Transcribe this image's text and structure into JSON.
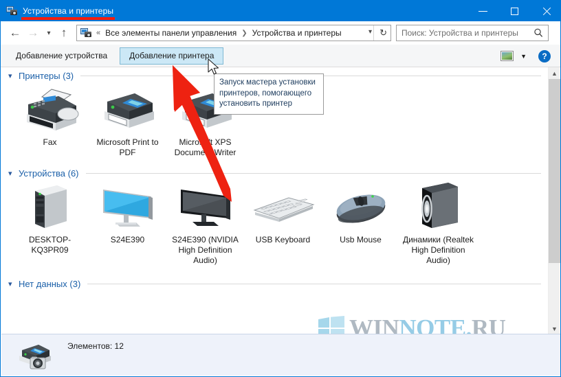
{
  "window": {
    "title": "Устройства и принтеры",
    "title_icon": "devices-printers-icon",
    "minimize_label": "Свернуть",
    "maximize_label": "Развернуть",
    "close_label": "Закрыть"
  },
  "address_bar": {
    "back_icon": "back-arrow-icon",
    "forward_icon": "forward-arrow-icon",
    "recent_icon": "recent-locations-icon",
    "up_icon": "up-arrow-icon",
    "overflow": "«",
    "crumb_icon": "devices-printers-icon",
    "crumbs": [
      "Все элементы панели управления",
      "Устройства и принтеры"
    ],
    "separator": "❯",
    "dropdown_icon": "chevron-down-icon",
    "refresh_icon": "refresh-icon"
  },
  "search": {
    "placeholder": "Поиск: Устройства и принтеры",
    "value": "",
    "icon": "search-icon"
  },
  "command_bar": {
    "add_device": "Добавление устройства",
    "add_printer": "Добавление принтера",
    "view_icon": "change-view-icon",
    "view_dropdown_icon": "chevron-down-icon",
    "help_label": "?",
    "help_icon": "help-icon"
  },
  "tooltip": {
    "text": "Запуск мастера установки принтеров, помогающего установить принтер"
  },
  "sections": [
    {
      "chevron": "⌄",
      "label": "Принтеры (3)",
      "name": "printers",
      "items": [
        {
          "label": "Fax",
          "icon": "fax-printer-icon"
        },
        {
          "label": "Microsoft Print to PDF",
          "icon": "printer-icon"
        },
        {
          "label": "Microsoft XPS Document Writer",
          "icon": "printer-icon"
        }
      ]
    },
    {
      "chevron": "⌄",
      "label": "Устройства (6)",
      "name": "devices",
      "items": [
        {
          "label": "DESKTOP-KQ3PR09",
          "icon": "desktop-tower-icon"
        },
        {
          "label": "S24E390",
          "icon": "monitor-icon"
        },
        {
          "label": "S24E390 (NVIDIA High Definition Audio)",
          "icon": "monitor-dark-icon"
        },
        {
          "label": "USB Keyboard",
          "icon": "keyboard-icon"
        },
        {
          "label": "Usb Mouse",
          "icon": "mouse-icon"
        },
        {
          "label": "Динамики (Realtek High Definition Audio)",
          "icon": "speaker-icon"
        }
      ]
    },
    {
      "chevron": "⌄",
      "label": "Нет данных (3)",
      "name": "unspecified",
      "items": []
    }
  ],
  "scrollbar": {
    "up_icon": "scroll-up-icon",
    "down_icon": "scroll-down-icon",
    "thumb": "scroll-thumb"
  },
  "status_bar": {
    "icon": "printer-camera-icon",
    "text": "Элементов: 12"
  },
  "watermark": {
    "logo_icon": "windows-logo-icon",
    "text_part1": "WIN",
    "text_part2": "NOTE",
    "text_part3": ".",
    "text_part4": "RU"
  },
  "annotations": {
    "red_arrow": "red-arrow-annotation",
    "red_underline": "red-underline-annotation",
    "cursor": "mouse-cursor"
  },
  "colors": {
    "accent": "#0078d7",
    "annotation_red": "#f51d0c",
    "section_header": "#1a5fa8",
    "hover_fill": "#cce8f6",
    "status_bg": "#eef2fa"
  }
}
